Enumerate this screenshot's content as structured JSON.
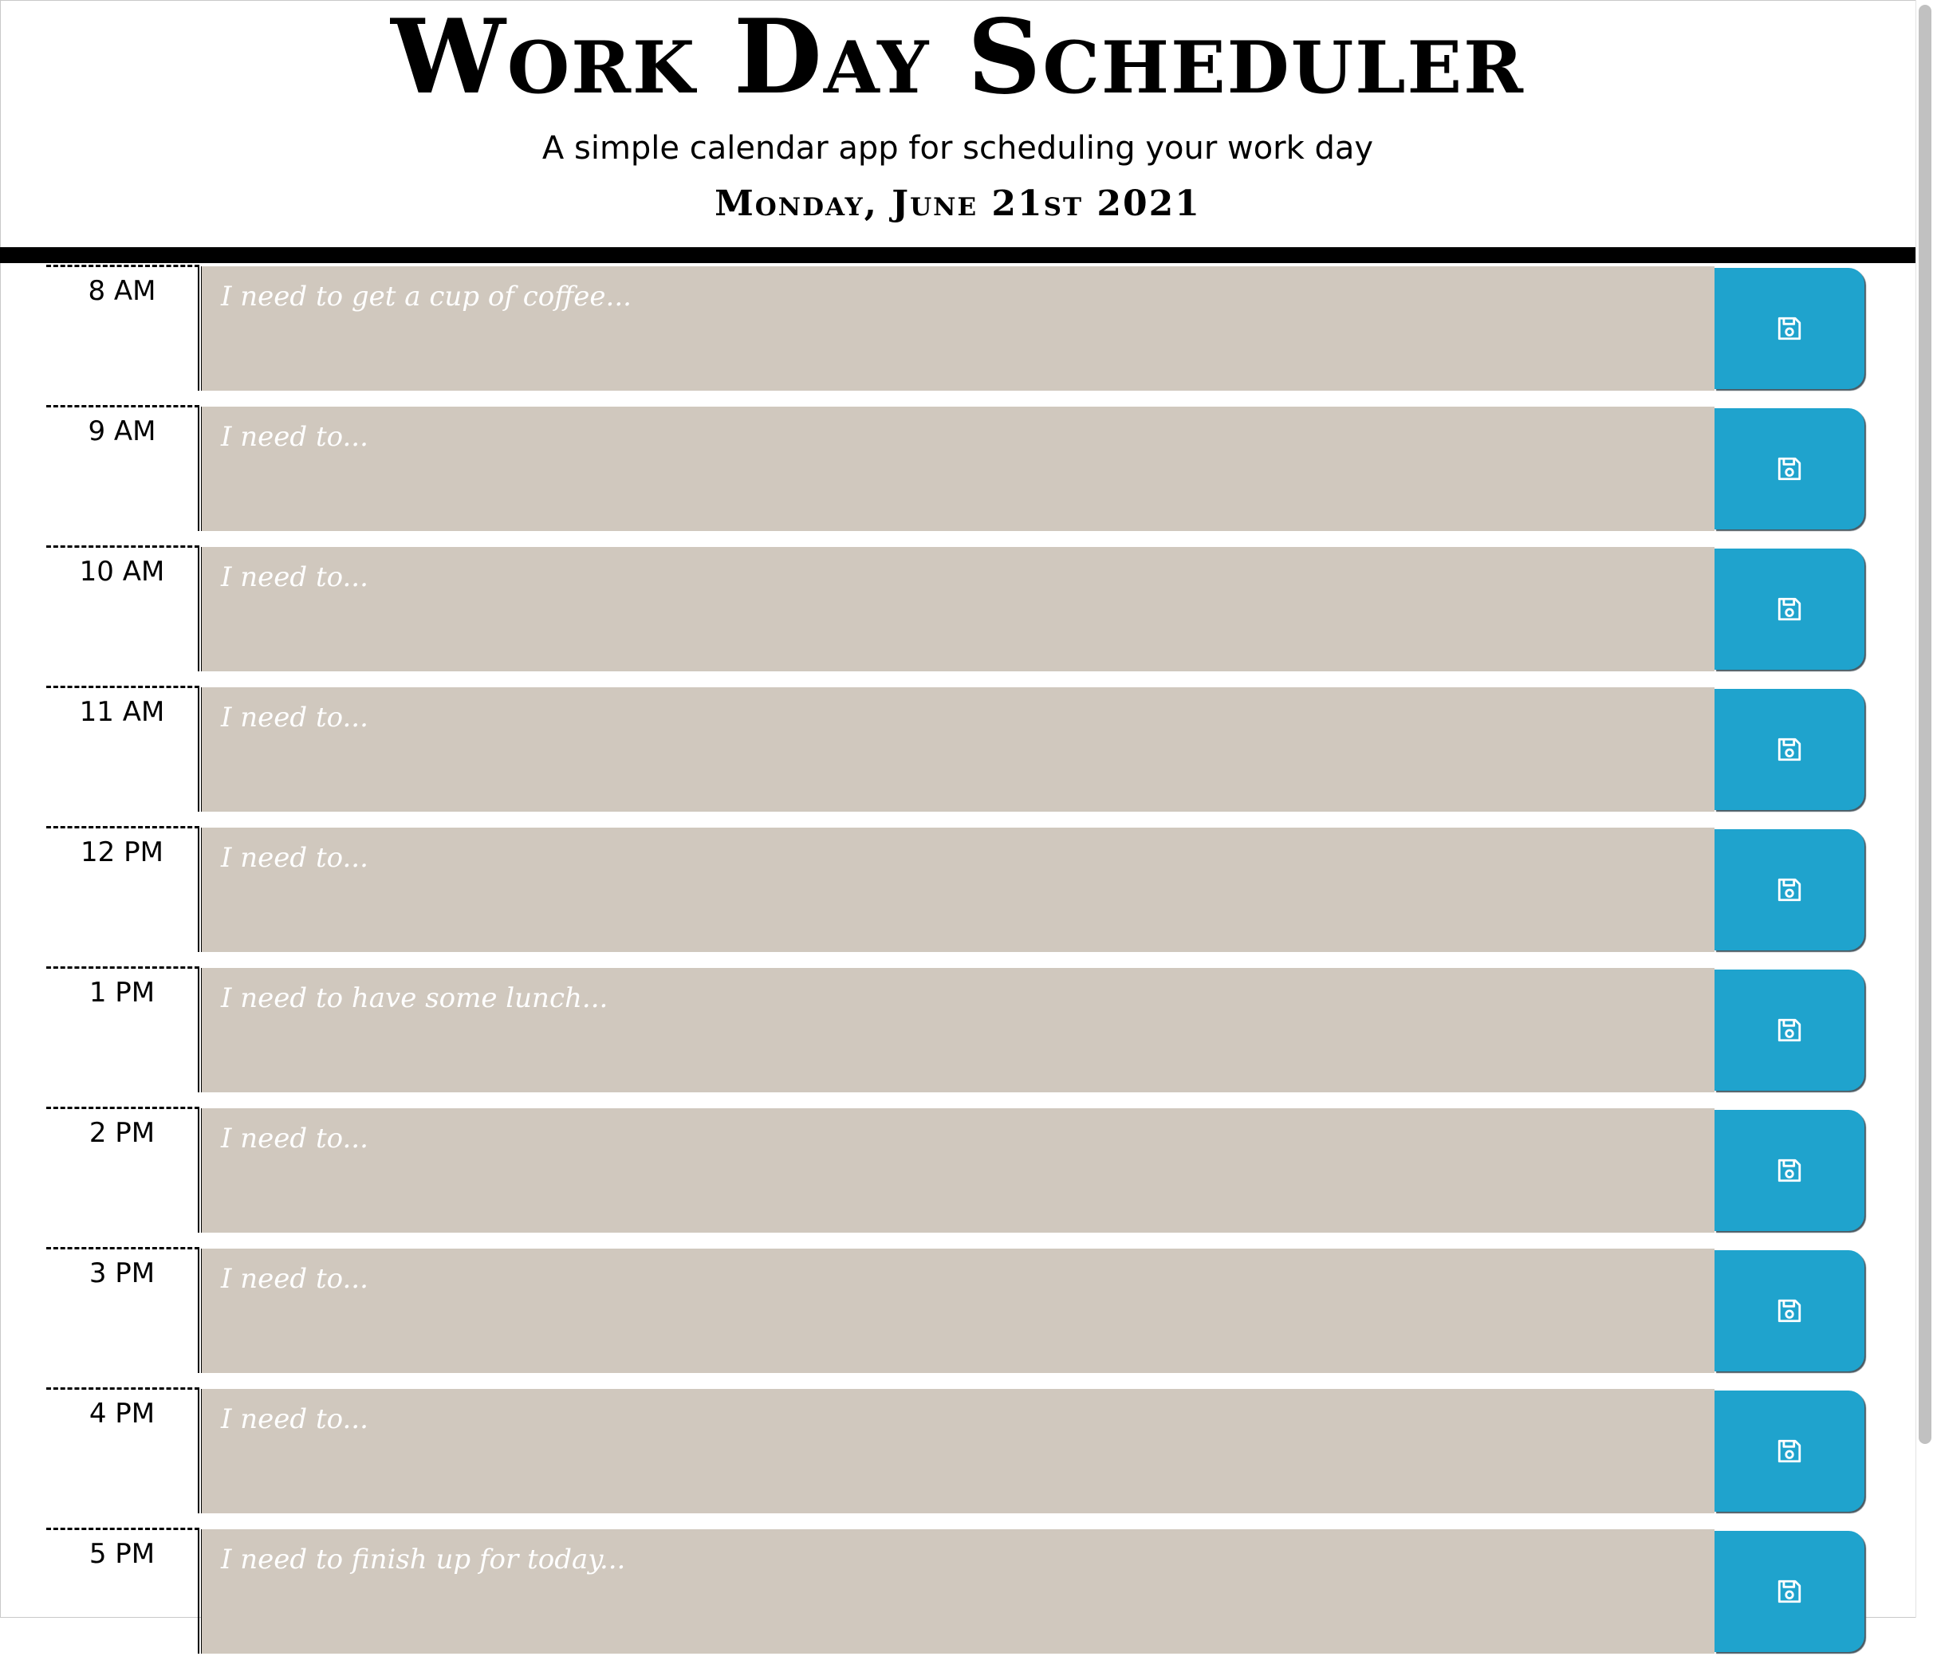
{
  "header": {
    "title": "Work Day Scheduler",
    "subtitle": "A simple calendar app for scheduling your work day",
    "current_day": "Monday, June 21st 2021"
  },
  "colors": {
    "row_background": "#d0c8be",
    "save_button": "#1fa3cd",
    "placeholder_text": "#ffffff"
  },
  "time_blocks": [
    {
      "hour": "8 AM",
      "placeholder": "I need to get a cup of coffee...",
      "save_icon": "floppy-disk-icon"
    },
    {
      "hour": "9 AM",
      "placeholder": "I need to...",
      "save_icon": "floppy-disk-icon"
    },
    {
      "hour": "10 AM",
      "placeholder": "I need to...",
      "save_icon": "floppy-disk-icon"
    },
    {
      "hour": "11 AM",
      "placeholder": "I need to...",
      "save_icon": "floppy-disk-icon"
    },
    {
      "hour": "12 PM",
      "placeholder": "I need to...",
      "save_icon": "floppy-disk-icon"
    },
    {
      "hour": "1 PM",
      "placeholder": "I need to have some lunch...",
      "save_icon": "floppy-disk-icon"
    },
    {
      "hour": "2 PM",
      "placeholder": "I need to...",
      "save_icon": "floppy-disk-icon"
    },
    {
      "hour": "3 PM",
      "placeholder": "I need to...",
      "save_icon": "floppy-disk-icon"
    },
    {
      "hour": "4 PM",
      "placeholder": "I need to...",
      "save_icon": "floppy-disk-icon"
    },
    {
      "hour": "5 PM",
      "placeholder": "I need to finish up for today...",
      "save_icon": "floppy-disk-icon"
    }
  ]
}
